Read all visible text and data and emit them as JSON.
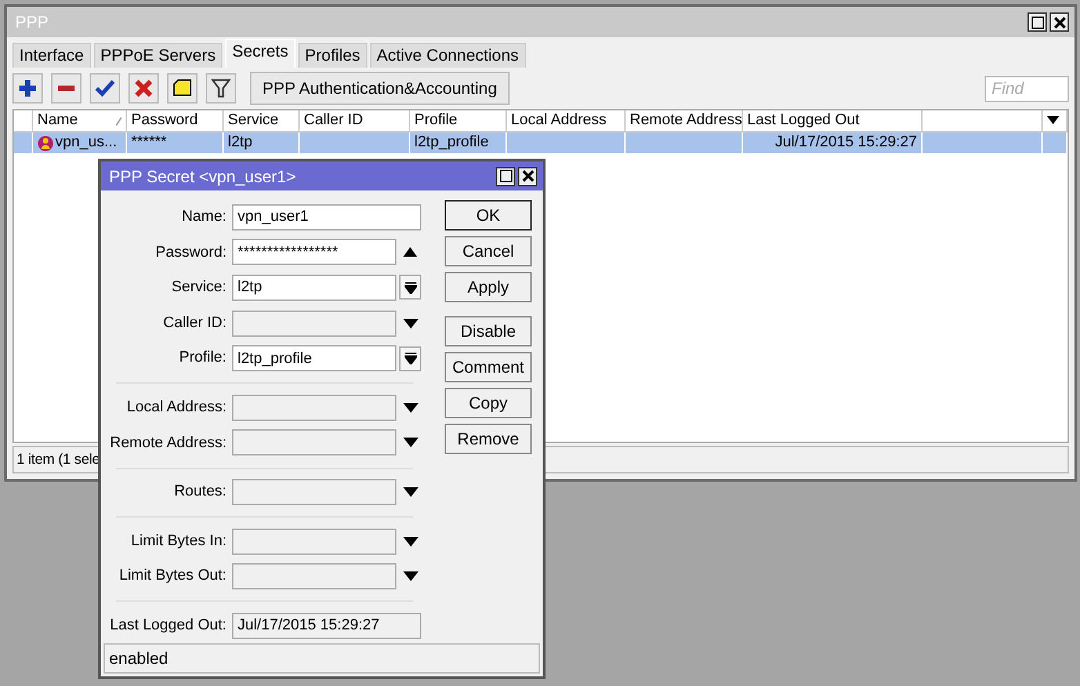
{
  "main_window": {
    "title": "PPP",
    "tabs": [
      {
        "label": "Interface",
        "selected": false
      },
      {
        "label": "PPPoE Servers",
        "selected": false
      },
      {
        "label": "Secrets",
        "selected": true
      },
      {
        "label": "Profiles",
        "selected": false
      },
      {
        "label": "Active Connections",
        "selected": false
      }
    ],
    "toolbar": {
      "buttons": [
        {
          "kind": "add"
        },
        {
          "kind": "remove"
        },
        {
          "kind": "enable"
        },
        {
          "kind": "disable"
        },
        {
          "kind": "comment"
        },
        {
          "kind": "filter"
        }
      ],
      "text_button": "PPP Authentication&Accounting",
      "search": {
        "placeholder": "Find"
      }
    },
    "table": {
      "columns": [
        "Name",
        "Password",
        "Service",
        "Caller ID",
        "Profile",
        "Local Address",
        "Remote Address",
        "Last Logged Out"
      ],
      "rows": [
        {
          "selected": true,
          "cells": [
            "vpn_us...",
            "******",
            "l2tp",
            "",
            "l2tp_profile",
            "",
            "",
            "Jul/17/2015 15:29:27"
          ]
        }
      ]
    },
    "status_bar": "1 item (1 sele"
  },
  "dialog": {
    "title": "PPP Secret <vpn_user1>",
    "groups": [
      [
        {
          "label": "Name:",
          "value": "vpn_user1",
          "disabled": false,
          "kind": "plain"
        },
        {
          "label": "Password:",
          "value": "*****************",
          "disabled": false,
          "kind": "hide"
        },
        {
          "label": "Service:",
          "value": "l2tp",
          "disabled": false,
          "kind": "select"
        },
        {
          "label": "Caller ID:",
          "disabled": true,
          "kind": "more"
        },
        {
          "label": "Profile:",
          "value": "l2tp_profile",
          "disabled": false,
          "kind": "select"
        }
      ],
      [
        {
          "label": "Local Address:",
          "disabled": true,
          "kind": "more"
        },
        {
          "label": "Remote Address:",
          "disabled": true,
          "kind": "more"
        }
      ],
      [
        {
          "label": "Routes:",
          "disabled": true,
          "kind": "more"
        }
      ],
      [
        {
          "label": "Limit Bytes In:",
          "disabled": true,
          "kind": "more"
        },
        {
          "label": "Limit Bytes Out:",
          "disabled": true,
          "kind": "more"
        }
      ],
      [
        {
          "label": "Last Logged Out:",
          "value": "Jul/17/2015 15:29:27",
          "disabled": true,
          "kind": "plain"
        }
      ]
    ],
    "button_groups": [
      [
        {
          "label": "OK",
          "default": true
        },
        {
          "label": "Cancel",
          "default": false
        },
        {
          "label": "Apply",
          "default": false
        }
      ],
      [
        {
          "label": "Disable",
          "default": false
        },
        {
          "label": "Comment",
          "default": false
        },
        {
          "label": "Copy",
          "default": false
        },
        {
          "label": "Remove",
          "default": false
        }
      ]
    ],
    "status": "enabled"
  }
}
